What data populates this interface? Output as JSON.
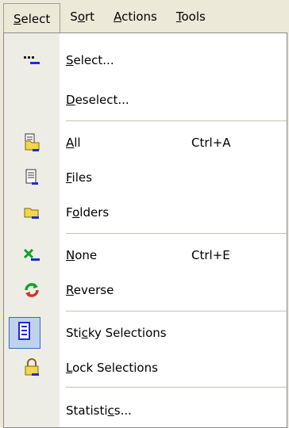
{
  "menubar": {
    "items": [
      {
        "label": "Select",
        "mnemonic": "S",
        "active": true
      },
      {
        "label": "Sort",
        "mnemonic": "o"
      },
      {
        "label": "Actions",
        "mnemonic": "A"
      },
      {
        "label": "Tools",
        "mnemonic": "T"
      }
    ]
  },
  "menu": {
    "items": [
      {
        "label": "Select...",
        "icon": "select-dots-icon"
      },
      {
        "label": "Deselect...",
        "icon": ""
      },
      {
        "label": "All",
        "shortcut": "Ctrl+A",
        "icon": "select-all-icon"
      },
      {
        "label": "Files",
        "icon": "select-files-icon"
      },
      {
        "label": "Folders",
        "icon": "select-folders-icon"
      },
      {
        "label": "None",
        "shortcut": "Ctrl+E",
        "icon": "select-none-icon"
      },
      {
        "label": "Reverse",
        "icon": "reverse-selection-icon"
      },
      {
        "label": "Sticky Selections",
        "icon": "sticky-selections-icon"
      },
      {
        "label": "Lock Selections",
        "icon": "lock-selections-icon"
      },
      {
        "label": "Statistics...",
        "icon": ""
      }
    ]
  },
  "colors": {
    "menu_bg": "#ece9d8",
    "gutter_bg": "#eeede5",
    "highlight_border": "#316ac5",
    "highlight_fill": "#c1d2ee",
    "icon_blue": "#1f2bd6",
    "icon_yellow": "#f3d64a",
    "icon_green": "#0ea12b",
    "icon_red": "#d4312a"
  }
}
